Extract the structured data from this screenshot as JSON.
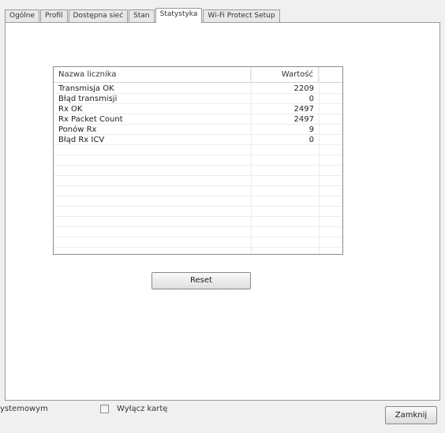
{
  "tabs": [
    {
      "label": "Ogólne"
    },
    {
      "label": "Profil"
    },
    {
      "label": "Dostępna sieć"
    },
    {
      "label": "Stan"
    },
    {
      "label": "Statystyka"
    },
    {
      "label": "Wi-Fi Protect Setup"
    }
  ],
  "active_tab": "Statystyka",
  "stats": {
    "col_name": "Nazwa licznika",
    "col_value": "Wartość",
    "rows": [
      {
        "name": "Transmisja OK",
        "value": "2209"
      },
      {
        "name": "Błąd transmisji",
        "value": "0"
      },
      {
        "name": "Rx OK",
        "value": "2497"
      },
      {
        "name": "Rx Packet Count",
        "value": "2497"
      },
      {
        "name": "Ponów Rx",
        "value": "9"
      },
      {
        "name": "Błąd Rx ICV",
        "value": "0"
      }
    ]
  },
  "reset_label": "Reset",
  "bottom": {
    "partial_text": "ystemowym",
    "checkbox_label": "Wyłącz kartę",
    "checkbox_checked": false,
    "close_label": "Zamknij"
  }
}
